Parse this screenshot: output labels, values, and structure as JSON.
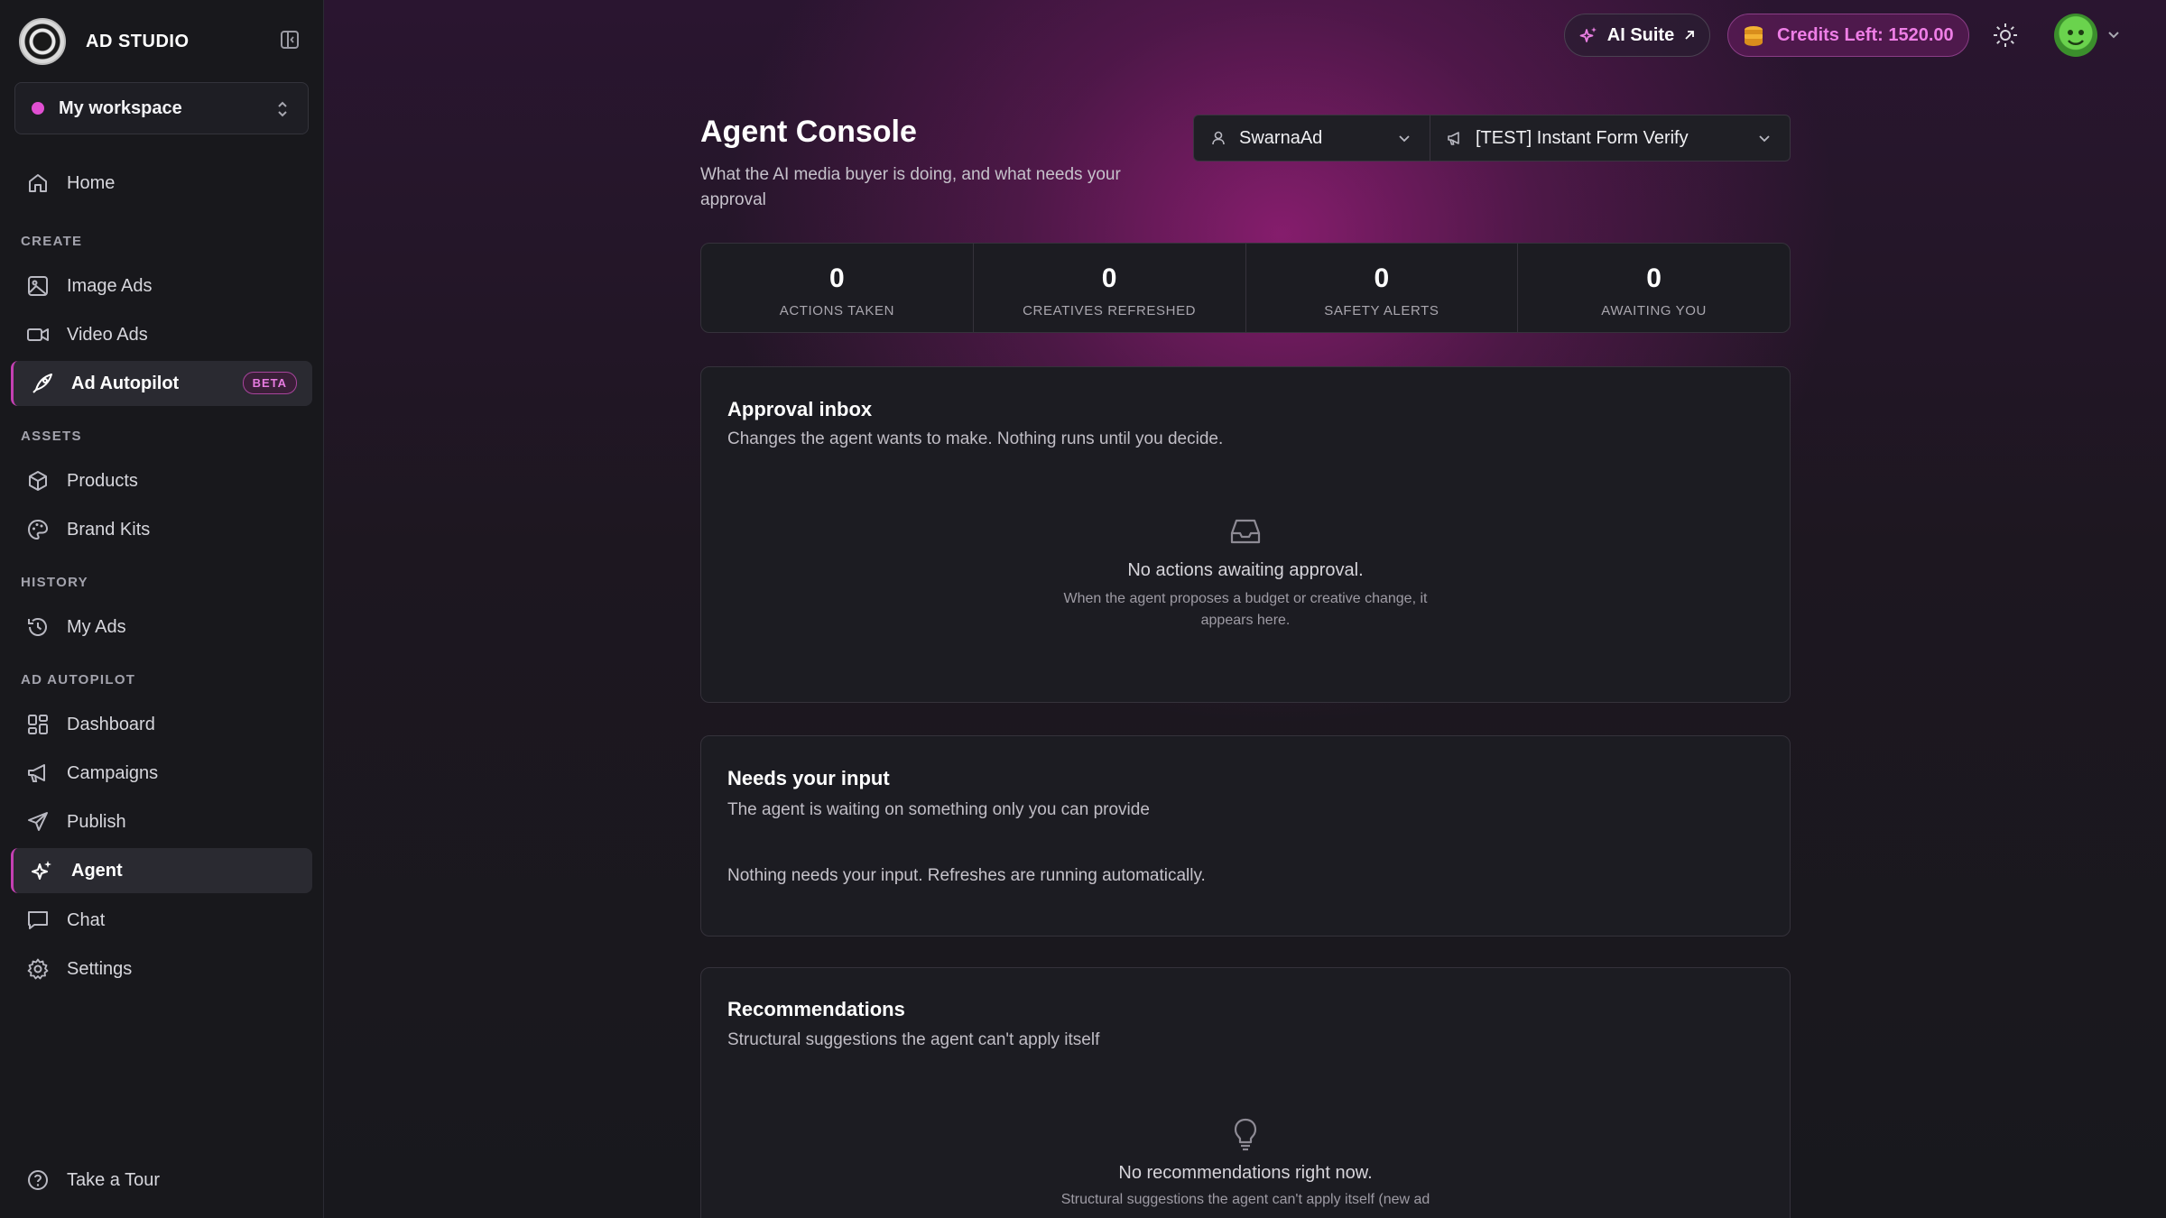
{
  "brand": {
    "name": "AD STUDIO"
  },
  "workspace": {
    "name": "My workspace"
  },
  "nav": {
    "home": "Home",
    "create_label": "CREATE",
    "image_ads": "Image Ads",
    "video_ads": "Video Ads",
    "ad_autopilot": "Ad Autopilot",
    "beta": "BETA",
    "assets_label": "ASSETS",
    "products": "Products",
    "brand_kits": "Brand Kits",
    "history_label": "HISTORY",
    "my_ads": "My Ads",
    "autopilot_label": "AD AUTOPILOT",
    "dashboard": "Dashboard",
    "campaigns": "Campaigns",
    "publish": "Publish",
    "agent": "Agent",
    "chat": "Chat",
    "settings": "Settings",
    "tour": "Take a Tour"
  },
  "topbar": {
    "ai_suite": "AI Suite",
    "credits": "Credits Left: 1520.00"
  },
  "page": {
    "title": "Agent Console",
    "subtitle": "What the AI media buyer is doing, and what needs your approval"
  },
  "selectors": {
    "account": "SwarnaAd",
    "campaign": "[TEST] Instant Form Verify"
  },
  "stats": [
    {
      "value": "0",
      "label": "ACTIONS TAKEN"
    },
    {
      "value": "0",
      "label": "CREATIVES REFRESHED"
    },
    {
      "value": "0",
      "label": "SAFETY ALERTS"
    },
    {
      "value": "0",
      "label": "AWAITING YOU"
    }
  ],
  "approval": {
    "title": "Approval inbox",
    "subtitle": "Changes the agent wants to make. Nothing runs until you decide.",
    "empty_title": "No actions awaiting approval.",
    "empty_desc": "When the agent proposes a budget or creative change, it appears here."
  },
  "input": {
    "title": "Needs your input",
    "subtitle": "The agent is waiting on something only you can provide",
    "message": "Nothing needs your input. Refreshes are running automatically."
  },
  "recs": {
    "title": "Recommendations",
    "subtitle": "Structural suggestions the agent can't apply itself",
    "empty_title": "No recommendations right now.",
    "empty_desc": "Structural suggestions the agent can't apply itself (new ad"
  },
  "colors": {
    "accent": "#c440b3",
    "credits": "#ee7ee6",
    "background": "#17171d"
  }
}
